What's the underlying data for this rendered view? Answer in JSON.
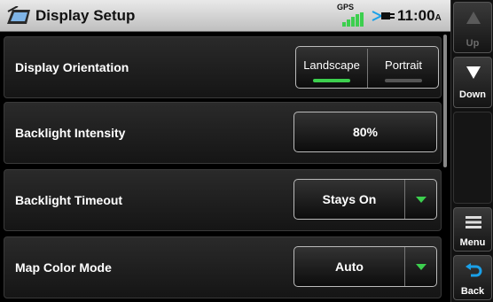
{
  "status": {
    "title": "Display Setup",
    "gps_label": "GPS",
    "time": "11:00",
    "time_suffix": "A"
  },
  "settings": [
    {
      "label": "Display Orientation",
      "control": "segmented",
      "options": [
        "Landscape",
        "Portrait"
      ],
      "selected": "Landscape"
    },
    {
      "label": "Backlight Intensity",
      "control": "button",
      "value": "80%"
    },
    {
      "label": "Backlight Timeout",
      "control": "dropdown",
      "value": "Stays On"
    },
    {
      "label": "Map Color Mode",
      "control": "dropdown",
      "value": "Auto"
    }
  ],
  "sidebar": {
    "up_label": "Up",
    "down_label": "Down",
    "menu_label": "Menu",
    "back_label": "Back"
  },
  "colors": {
    "accent_green": "#3ccf4e",
    "indicator_off": "#555555",
    "disabled_text": "#6b6b6b"
  },
  "icons": {
    "app": "display-setup-icon",
    "gps": "gps-signal-icon",
    "power": "external-power-icon",
    "up": "arrow-up-icon",
    "down": "arrow-down-icon",
    "menu": "menu-icon",
    "back": "back-arrow-icon",
    "dropdown": "dropdown-arrow-icon"
  }
}
